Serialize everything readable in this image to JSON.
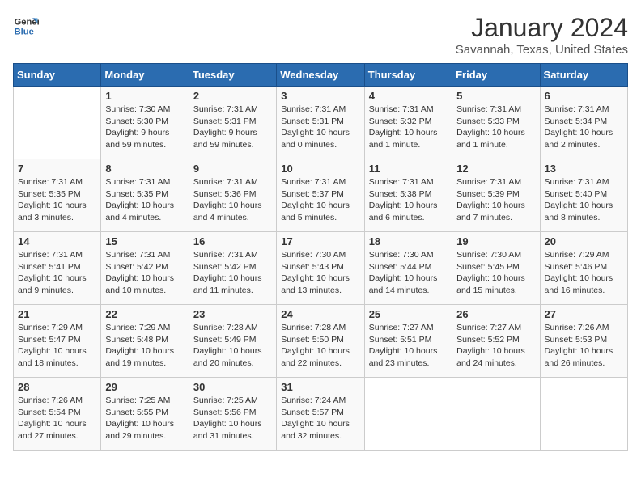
{
  "header": {
    "logo_general": "General",
    "logo_blue": "Blue",
    "title": "January 2024",
    "subtitle": "Savannah, Texas, United States"
  },
  "days_of_week": [
    "Sunday",
    "Monday",
    "Tuesday",
    "Wednesday",
    "Thursday",
    "Friday",
    "Saturday"
  ],
  "weeks": [
    [
      {
        "day": "",
        "info": ""
      },
      {
        "day": "1",
        "info": "Sunrise: 7:30 AM\nSunset: 5:30 PM\nDaylight: 9 hours\nand 59 minutes."
      },
      {
        "day": "2",
        "info": "Sunrise: 7:31 AM\nSunset: 5:31 PM\nDaylight: 9 hours\nand 59 minutes."
      },
      {
        "day": "3",
        "info": "Sunrise: 7:31 AM\nSunset: 5:31 PM\nDaylight: 10 hours\nand 0 minutes."
      },
      {
        "day": "4",
        "info": "Sunrise: 7:31 AM\nSunset: 5:32 PM\nDaylight: 10 hours\nand 1 minute."
      },
      {
        "day": "5",
        "info": "Sunrise: 7:31 AM\nSunset: 5:33 PM\nDaylight: 10 hours\nand 1 minute."
      },
      {
        "day": "6",
        "info": "Sunrise: 7:31 AM\nSunset: 5:34 PM\nDaylight: 10 hours\nand 2 minutes."
      }
    ],
    [
      {
        "day": "7",
        "info": "Sunrise: 7:31 AM\nSunset: 5:35 PM\nDaylight: 10 hours\nand 3 minutes."
      },
      {
        "day": "8",
        "info": "Sunrise: 7:31 AM\nSunset: 5:35 PM\nDaylight: 10 hours\nand 4 minutes."
      },
      {
        "day": "9",
        "info": "Sunrise: 7:31 AM\nSunset: 5:36 PM\nDaylight: 10 hours\nand 4 minutes."
      },
      {
        "day": "10",
        "info": "Sunrise: 7:31 AM\nSunset: 5:37 PM\nDaylight: 10 hours\nand 5 minutes."
      },
      {
        "day": "11",
        "info": "Sunrise: 7:31 AM\nSunset: 5:38 PM\nDaylight: 10 hours\nand 6 minutes."
      },
      {
        "day": "12",
        "info": "Sunrise: 7:31 AM\nSunset: 5:39 PM\nDaylight: 10 hours\nand 7 minutes."
      },
      {
        "day": "13",
        "info": "Sunrise: 7:31 AM\nSunset: 5:40 PM\nDaylight: 10 hours\nand 8 minutes."
      }
    ],
    [
      {
        "day": "14",
        "info": "Sunrise: 7:31 AM\nSunset: 5:41 PM\nDaylight: 10 hours\nand 9 minutes."
      },
      {
        "day": "15",
        "info": "Sunrise: 7:31 AM\nSunset: 5:42 PM\nDaylight: 10 hours\nand 10 minutes."
      },
      {
        "day": "16",
        "info": "Sunrise: 7:31 AM\nSunset: 5:42 PM\nDaylight: 10 hours\nand 11 minutes."
      },
      {
        "day": "17",
        "info": "Sunrise: 7:30 AM\nSunset: 5:43 PM\nDaylight: 10 hours\nand 13 minutes."
      },
      {
        "day": "18",
        "info": "Sunrise: 7:30 AM\nSunset: 5:44 PM\nDaylight: 10 hours\nand 14 minutes."
      },
      {
        "day": "19",
        "info": "Sunrise: 7:30 AM\nSunset: 5:45 PM\nDaylight: 10 hours\nand 15 minutes."
      },
      {
        "day": "20",
        "info": "Sunrise: 7:29 AM\nSunset: 5:46 PM\nDaylight: 10 hours\nand 16 minutes."
      }
    ],
    [
      {
        "day": "21",
        "info": "Sunrise: 7:29 AM\nSunset: 5:47 PM\nDaylight: 10 hours\nand 18 minutes."
      },
      {
        "day": "22",
        "info": "Sunrise: 7:29 AM\nSunset: 5:48 PM\nDaylight: 10 hours\nand 19 minutes."
      },
      {
        "day": "23",
        "info": "Sunrise: 7:28 AM\nSunset: 5:49 PM\nDaylight: 10 hours\nand 20 minutes."
      },
      {
        "day": "24",
        "info": "Sunrise: 7:28 AM\nSunset: 5:50 PM\nDaylight: 10 hours\nand 22 minutes."
      },
      {
        "day": "25",
        "info": "Sunrise: 7:27 AM\nSunset: 5:51 PM\nDaylight: 10 hours\nand 23 minutes."
      },
      {
        "day": "26",
        "info": "Sunrise: 7:27 AM\nSunset: 5:52 PM\nDaylight: 10 hours\nand 24 minutes."
      },
      {
        "day": "27",
        "info": "Sunrise: 7:26 AM\nSunset: 5:53 PM\nDaylight: 10 hours\nand 26 minutes."
      }
    ],
    [
      {
        "day": "28",
        "info": "Sunrise: 7:26 AM\nSunset: 5:54 PM\nDaylight: 10 hours\nand 27 minutes."
      },
      {
        "day": "29",
        "info": "Sunrise: 7:25 AM\nSunset: 5:55 PM\nDaylight: 10 hours\nand 29 minutes."
      },
      {
        "day": "30",
        "info": "Sunrise: 7:25 AM\nSunset: 5:56 PM\nDaylight: 10 hours\nand 31 minutes."
      },
      {
        "day": "31",
        "info": "Sunrise: 7:24 AM\nSunset: 5:57 PM\nDaylight: 10 hours\nand 32 minutes."
      },
      {
        "day": "",
        "info": ""
      },
      {
        "day": "",
        "info": ""
      },
      {
        "day": "",
        "info": ""
      }
    ]
  ]
}
